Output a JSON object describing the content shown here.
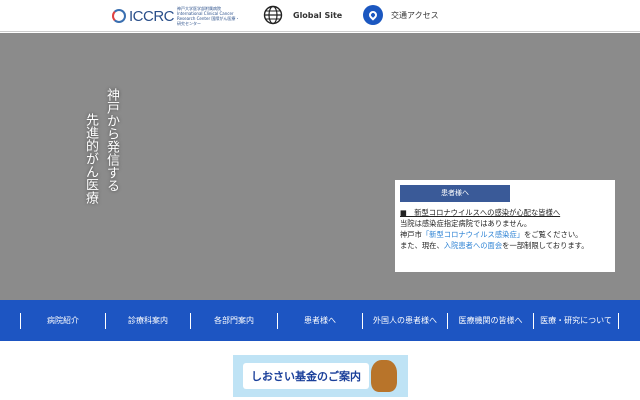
{
  "header": {
    "logo_text": "ICCRC",
    "logo_sub": "神戸大学医学部附属病院 International Clinical Cancer Research Center 国際がん医療・研究センター",
    "global_site": "Global Site",
    "access": "交通アクセス"
  },
  "hero": {
    "slogan_line1": "神戸から発信する",
    "slogan_line2": "先進的がん医療"
  },
  "notice": {
    "button": "患者様へ",
    "title": "■　新型コロナウイルスへの感染が心配な皆様へ",
    "line1": "当院は感染症指定病院ではありません。",
    "line2_pre": "神戸市",
    "line2_link": "「新型コロナウイルス感染症」",
    "line2_post": "をご覧ください。",
    "line3_pre": "また、現在、",
    "line3_link": "入院患者への面会",
    "line3_post": "を一部制限しております。"
  },
  "nav": {
    "items": [
      "病院紹介",
      "診療科案内",
      "各部門案内",
      "患者様へ",
      "外国人の患者様へ",
      "医療機関の皆様へ",
      "医療・研究について"
    ]
  },
  "banner": {
    "text": "しおさい基金のご案内"
  },
  "colors": {
    "nav": "#1d55c2",
    "hero": "#8b8b8b",
    "link": "#2c82d4"
  }
}
